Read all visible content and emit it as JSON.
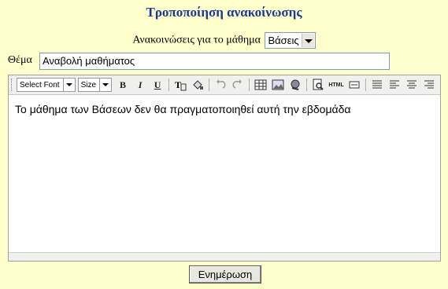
{
  "page": {
    "title": "Τροποποίηση ανακοίνωσης"
  },
  "course": {
    "label": "Ανακοινώσεις για το μάθημα",
    "selected": "Βάσεις"
  },
  "subject": {
    "label": "Θέμα",
    "value": "Αναβολή μαθήματος"
  },
  "toolbar": {
    "font_select": "Select Font",
    "size_select": "Size",
    "bold": "B",
    "italic": "I",
    "underline": "U",
    "html": "HTML"
  },
  "editor": {
    "content": "Το μάθημα των Βάσεων δεν θα πραγματοποιηθεί αυτή την εβδομάδα"
  },
  "form": {
    "submit_label": "Ενημέρωση"
  }
}
